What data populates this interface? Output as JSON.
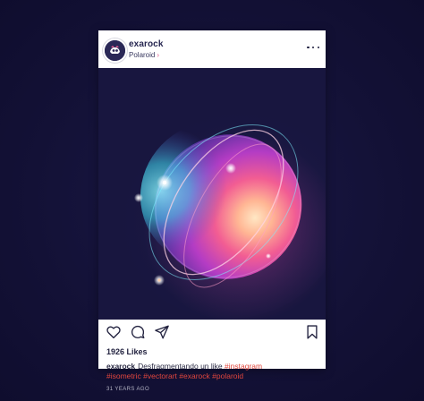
{
  "post": {
    "username": "exarock",
    "location": "Polaroid",
    "location_chevron": "›",
    "more_icon": "more-horizontal-icon",
    "likes": "1926 Likes",
    "caption": {
      "user": "exarock",
      "text": "Desfragmentando un like",
      "tags": [
        "#instagram",
        "#isometric",
        "#vectorart",
        "#exarock",
        "#polaroid"
      ]
    },
    "timestamp": "31 YEARS AGO"
  },
  "actions": {
    "like_icon": "heart-icon",
    "comment_icon": "comment-icon",
    "share_icon": "send-icon",
    "save_icon": "bookmark-icon"
  },
  "colors": {
    "background": "#14123a",
    "hashtag": "#e0463c",
    "username": "#262650"
  }
}
